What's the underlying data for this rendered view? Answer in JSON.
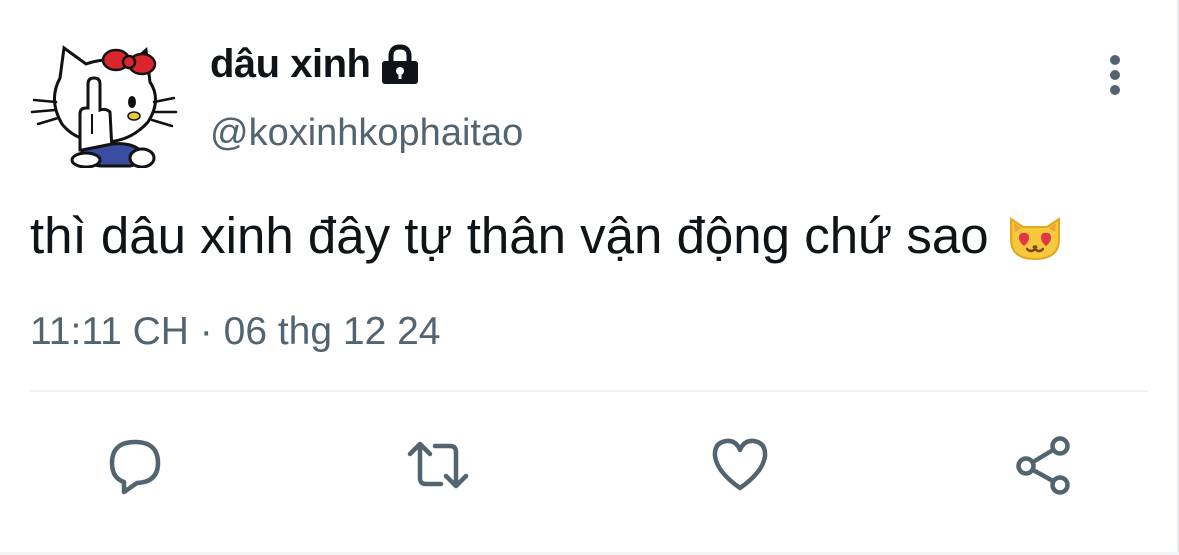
{
  "tweet": {
    "author": {
      "display_name": "dâu xinh",
      "handle": "@koxinhkophaitao",
      "avatar_icon": "hello-kitty-avatar",
      "protected_icon": "lock-icon"
    },
    "text": "thì dâu xinh đây tự thân vận động chứ sao",
    "emoji_icon": "smiling-cat-heart-eyes-emoji",
    "timestamp": "11:11 CH · 06 thg 12 24"
  },
  "actions": [
    {
      "name": "reply",
      "icon": "reply-icon"
    },
    {
      "name": "retweet",
      "icon": "retweet-icon"
    },
    {
      "name": "like",
      "icon": "heart-icon"
    },
    {
      "name": "share",
      "icon": "share-icon"
    }
  ],
  "colors": {
    "text_primary": "#0f1419",
    "text_secondary": "#536471",
    "icon": "#536471",
    "divider": "#eff1f3"
  }
}
